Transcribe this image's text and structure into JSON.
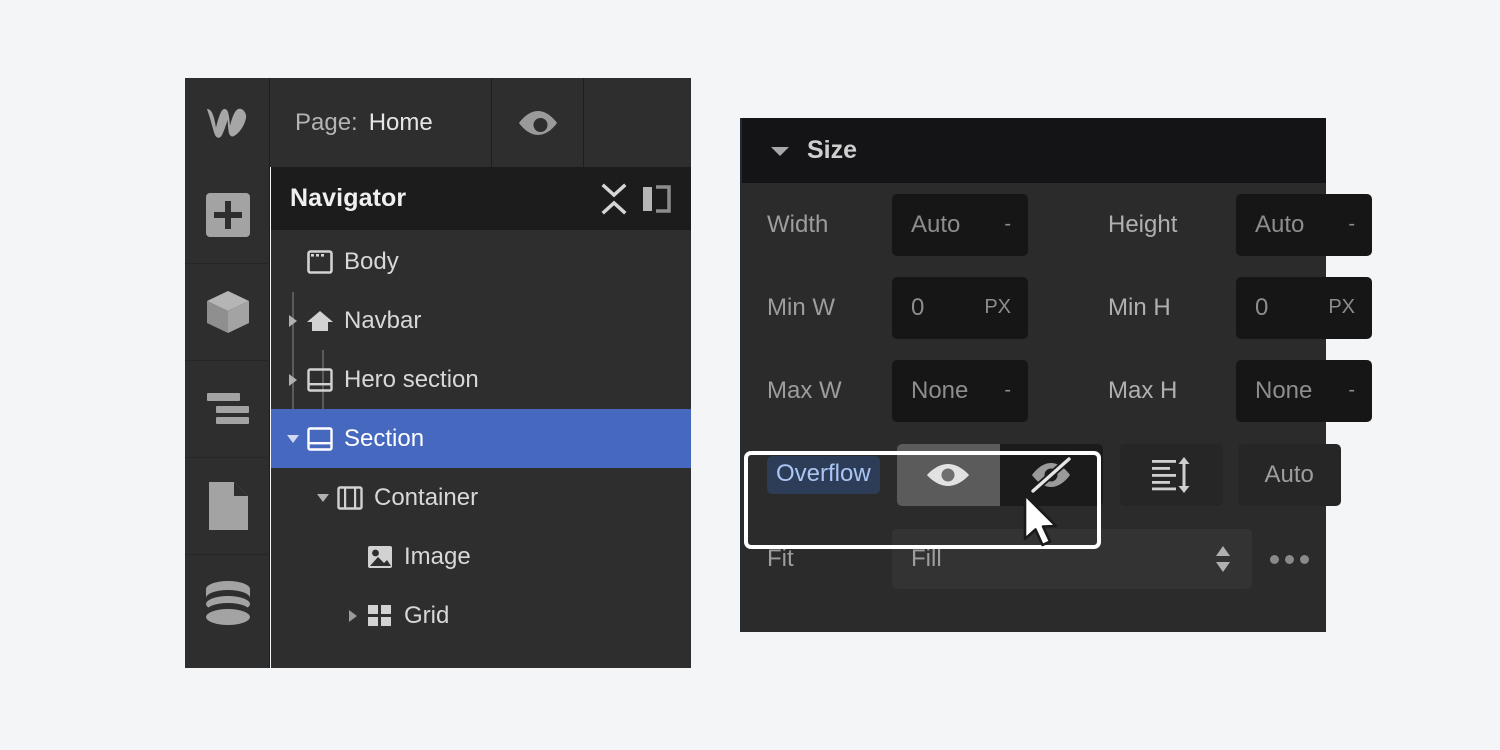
{
  "app": {
    "logo_icon": "webflow-w-logo"
  },
  "topbar": {
    "page_label": "Page:",
    "page_value": "Home",
    "preview_icon": "eye-icon"
  },
  "left_rail": {
    "items": [
      {
        "name": "add-elements",
        "icon": "plus-square-icon"
      },
      {
        "name": "components",
        "icon": "cube-icon"
      },
      {
        "name": "style-manager",
        "icon": "lines-icon"
      },
      {
        "name": "pages",
        "icon": "page-icon"
      },
      {
        "name": "cms",
        "icon": "database-icon"
      }
    ]
  },
  "navigator": {
    "title": "Navigator",
    "collapse_icon": "collapse-all-icon",
    "panel_icon": "panel-layout-icon",
    "tree": [
      {
        "label": "Body",
        "icon": "body-icon",
        "depth": 0,
        "twisty": "none",
        "selected": false
      },
      {
        "label": "Navbar",
        "icon": "navbar-icon",
        "depth": 0,
        "twisty": "collapsed",
        "selected": false
      },
      {
        "label": "Hero section",
        "icon": "section-icon",
        "depth": 0,
        "twisty": "collapsed",
        "selected": false
      },
      {
        "label": "Section",
        "icon": "section-icon",
        "depth": 0,
        "twisty": "expanded",
        "selected": true
      },
      {
        "label": "Container",
        "icon": "container-icon",
        "depth": 1,
        "twisty": "expanded",
        "selected": false
      },
      {
        "label": "Image",
        "icon": "image-icon",
        "depth": 2,
        "twisty": "none",
        "selected": false
      },
      {
        "label": "Grid",
        "icon": "grid-icon",
        "depth": 2,
        "twisty": "collapsed",
        "selected": false
      }
    ]
  },
  "size_panel": {
    "title": "Size",
    "collapse_icon": "caret-down-icon",
    "fields": {
      "width": {
        "label": "Width",
        "value": "Auto",
        "unit": "-"
      },
      "height": {
        "label": "Height",
        "value": "Auto",
        "unit": "-"
      },
      "min_w": {
        "label": "Min W",
        "value": "0",
        "unit": "PX"
      },
      "min_h": {
        "label": "Min H",
        "value": "0",
        "unit": "PX"
      },
      "max_w": {
        "label": "Max W",
        "value": "None",
        "unit": "-"
      },
      "max_h": {
        "label": "Max H",
        "value": "None",
        "unit": "-"
      }
    },
    "overflow": {
      "label": "Overflow",
      "options": [
        {
          "name": "overflow-visible",
          "icon": "eye-icon",
          "selected": true
        },
        {
          "name": "overflow-hidden",
          "icon": "eye-slash-icon",
          "selected": false
        },
        {
          "name": "overflow-scroll",
          "icon": "scroll-icon",
          "selected": false
        }
      ],
      "auto_label": "Auto"
    },
    "fit": {
      "label": "Fit",
      "value": "Fill",
      "stepper_icon": "up-down-caret-icon",
      "more_icon": "more-dots-icon"
    }
  },
  "colors": {
    "selection_blue": "#4668bf",
    "panel_bg": "#2b2b2b",
    "header_bg": "#141417",
    "highlight_outline": "#ffffff",
    "label_highlight_bg": "#2d3c57",
    "label_highlight_text": "#a9c6f5"
  },
  "cursor": {
    "icon": "mouse-pointer-icon"
  }
}
